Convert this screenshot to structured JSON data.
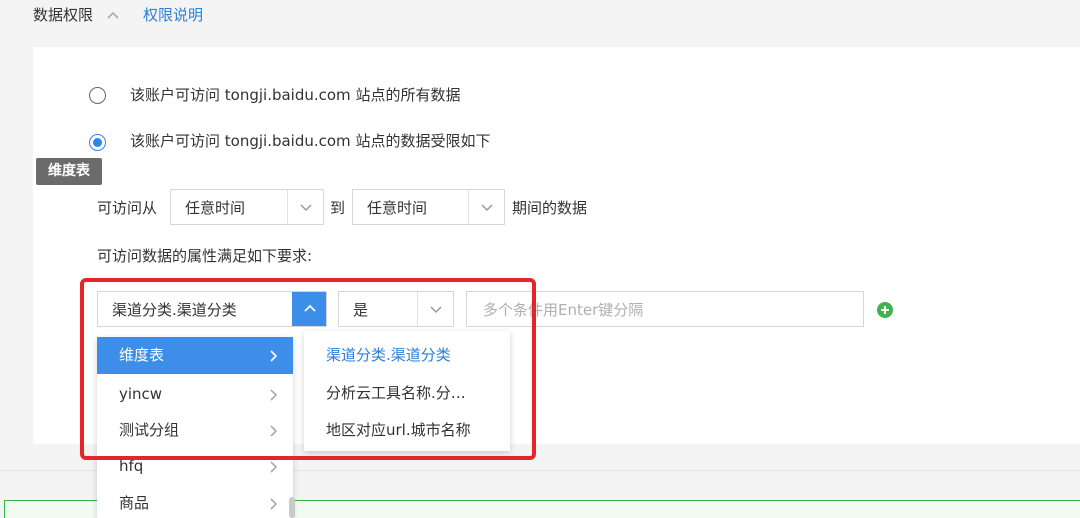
{
  "header": {
    "title": "数据权限",
    "help_link": "权限说明"
  },
  "access": {
    "option_all": "该账户可访问 tongji.baidu.com 站点的所有数据",
    "option_limited": "该账户可访问 tongji.baidu.com 站点的数据受限如下",
    "selected": "limited"
  },
  "tooltip_tag": "维度表",
  "time_range": {
    "prefix": "可访问从",
    "from_value": "任意时间",
    "to_label": "到",
    "to_value": "任意时间",
    "suffix": "期间的数据"
  },
  "conditions": {
    "title": "可访问数据的属性满足如下要求:",
    "attribute_value": "渠道分类.渠道分类",
    "operator_value": "是",
    "input_placeholder": "多个条件用Enter键分隔"
  },
  "dropdown": {
    "groups": [
      {
        "label": "维度表",
        "active": true
      },
      {
        "label": "yincw",
        "active": false
      },
      {
        "label": "测试分组",
        "active": false
      },
      {
        "label": "hfq",
        "active": false
      },
      {
        "label": "商品",
        "active": false
      }
    ],
    "sub_items": [
      {
        "label": "渠道分类.渠道分类",
        "selected": true
      },
      {
        "label": "分析云工具名称.分…",
        "selected": false
      },
      {
        "label": "地区对应url.城市名称",
        "selected": false
      }
    ]
  },
  "colors": {
    "accent": "#3d8ee8",
    "link": "#2d7fd6",
    "highlight_frame": "#e4252b",
    "add_button": "#3fb34f"
  }
}
